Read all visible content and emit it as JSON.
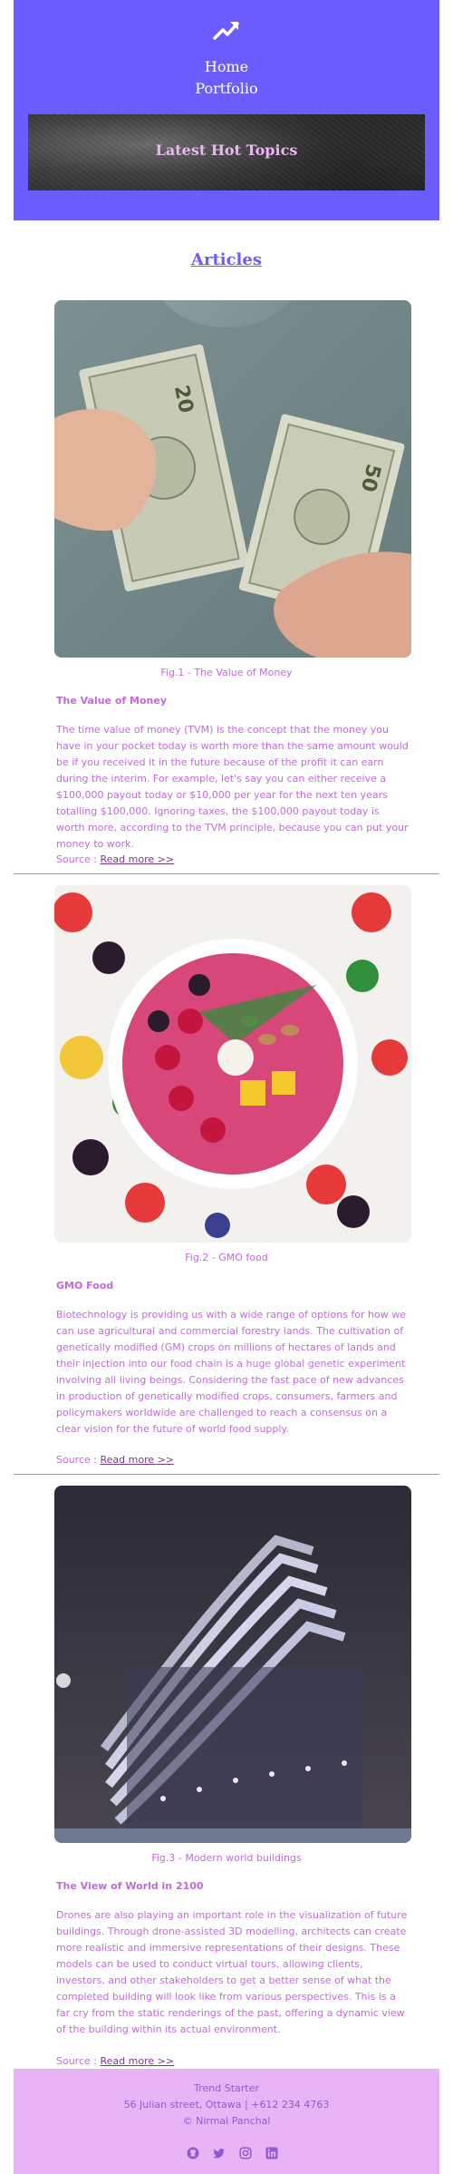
{
  "header": {
    "logo_icon": "trending-up-icon",
    "nav": [
      "Home",
      "Portfolio"
    ],
    "banner_title": "Latest Hot Topics",
    "bg_color": "#6a5cff"
  },
  "section_title": "Articles",
  "articles": [
    {
      "image": "money-photo",
      "caption": "Fig.1 - The Value of Money",
      "title": "The Value of Money",
      "body": "The time value of money (TVM) is the concept that the money you have in your pocket today is worth more than the same amount would be if you received it in the future because of the profit it can earn during the interim. For example, let's say you can either receive a $100,000 payout today or $10,000 per year for the next ten years totalling $100,000. Ignoring taxes, the $100,000 payout today is worth more, according to the TVM principle, because you can put your money to work.",
      "source_label": "Source : ",
      "source_link": "Read more >>"
    },
    {
      "image": "fruit-bowl-photo",
      "caption": "Fig.2 - GMO food",
      "title": "GMO Food",
      "body": "Biotechnology is providing us with a wide range of options for how we can use agricultural and commercial forestry lands. The cultivation of genetically modified (GM) crops on millions of hectares of lands and their injection into our food chain is a huge global genetic experiment involving all living beings. Considering the fast pace of new advances in production of genetically modified crops, consumers, farmers and policymakers worldwide are challenged to reach a consensus on a clear vision for the future of world food supply.",
      "source_label": "Source : ",
      "source_link": "Read more >>"
    },
    {
      "image": "modern-building-photo",
      "caption": "Fig.3 - Modern world buildings",
      "title": "The View of World in 2100",
      "body": "Drones are also playing an important role in the visualization of future buildings. Through drone-assisted 3D modelling, architects can create more realistic and immersive representations of their designs. These models can be used to conduct virtual tours, allowing clients, investors, and other stakeholders to get a better sense of what the completed building will look like from various perspectives. This is a far cry from the static renderings of the past, offering a dynamic view of the building within its actual environment.",
      "source_label": "Source : ",
      "source_link": "Read more >>"
    }
  ],
  "footer": {
    "company": "Trend Starter",
    "address": "56 Julian street, Ottawa | +612 234 4763",
    "copyright": "© Nirmal Panchal",
    "social_icons": [
      "github-icon",
      "twitter-icon",
      "instagram-icon",
      "linkedin-icon"
    ],
    "bg_color": "#e8b4f5"
  }
}
